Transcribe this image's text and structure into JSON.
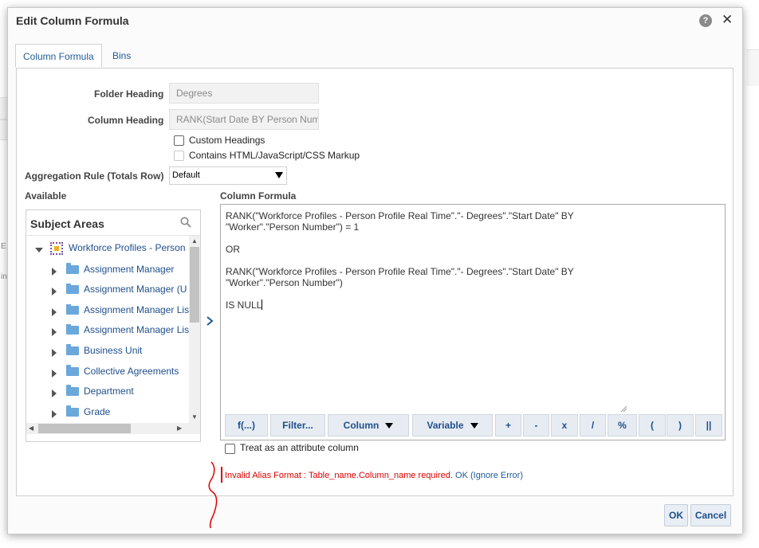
{
  "dialog": {
    "title": "Edit Column Formula"
  },
  "background": {
    "letter_e": "E",
    "letter_in": "in"
  },
  "tabs": [
    {
      "label": "Column Formula",
      "active": true
    },
    {
      "label": "Bins",
      "active": false
    }
  ],
  "form": {
    "folder_heading_label": "Folder Heading",
    "folder_heading_value": "Degrees",
    "column_heading_label": "Column Heading",
    "column_heading_value": "RANK(Start Date BY Person Number)",
    "custom_headings_label": "Custom Headings",
    "custom_headings_checked": false,
    "contains_markup_label": "Contains HTML/JavaScript/CSS Markup",
    "contains_markup_checked": false,
    "aggregation_label": "Aggregation Rule (Totals Row)",
    "aggregation_value": "Default",
    "available_label": "Available",
    "column_formula_label": "Column Formula"
  },
  "tree": {
    "header": "Subject Areas",
    "root": "Workforce Profiles - Person",
    "items": [
      "Assignment Manager",
      "Assignment Manager (U",
      "Assignment Manager Lis",
      "Assignment Manager Lis",
      "Business Unit",
      "Collective Agreements",
      "Department",
      "Grade"
    ]
  },
  "formula": {
    "lines": [
      "RANK(\"Workforce Profiles - Person Profile Real Time\".\"- Degrees\".\"Start Date\" BY",
      "\"Worker\".\"Person Number\") = 1",
      "",
      "OR",
      "",
      "RANK(\"Workforce Profiles - Person Profile Real Time\".\"- Degrees\".\"Start Date\" BY",
      "\"Worker\".\"Person Number\")",
      "",
      "IS NULL"
    ]
  },
  "toolbar": {
    "function": "f(...)",
    "filter": "Filter...",
    "column": "Column",
    "variable": "Variable",
    "plus": "+",
    "minus": "-",
    "multiply": "x",
    "divide": "/",
    "percent": "%",
    "open_paren": "(",
    "close_paren": ")",
    "concat": "||"
  },
  "attribute": {
    "label": "Treat as an attribute column",
    "checked": false
  },
  "error": {
    "message": "Invalid Alias Format : Table_name.Column_name required.",
    "ok_link": "OK",
    "ignore_link": "(Ignore Error)"
  },
  "buttons": {
    "ok": "OK",
    "cancel": "Cancel"
  },
  "colors": {
    "accent": "#1f5a96",
    "error": "#dd0000",
    "annotation": "#e00000"
  }
}
